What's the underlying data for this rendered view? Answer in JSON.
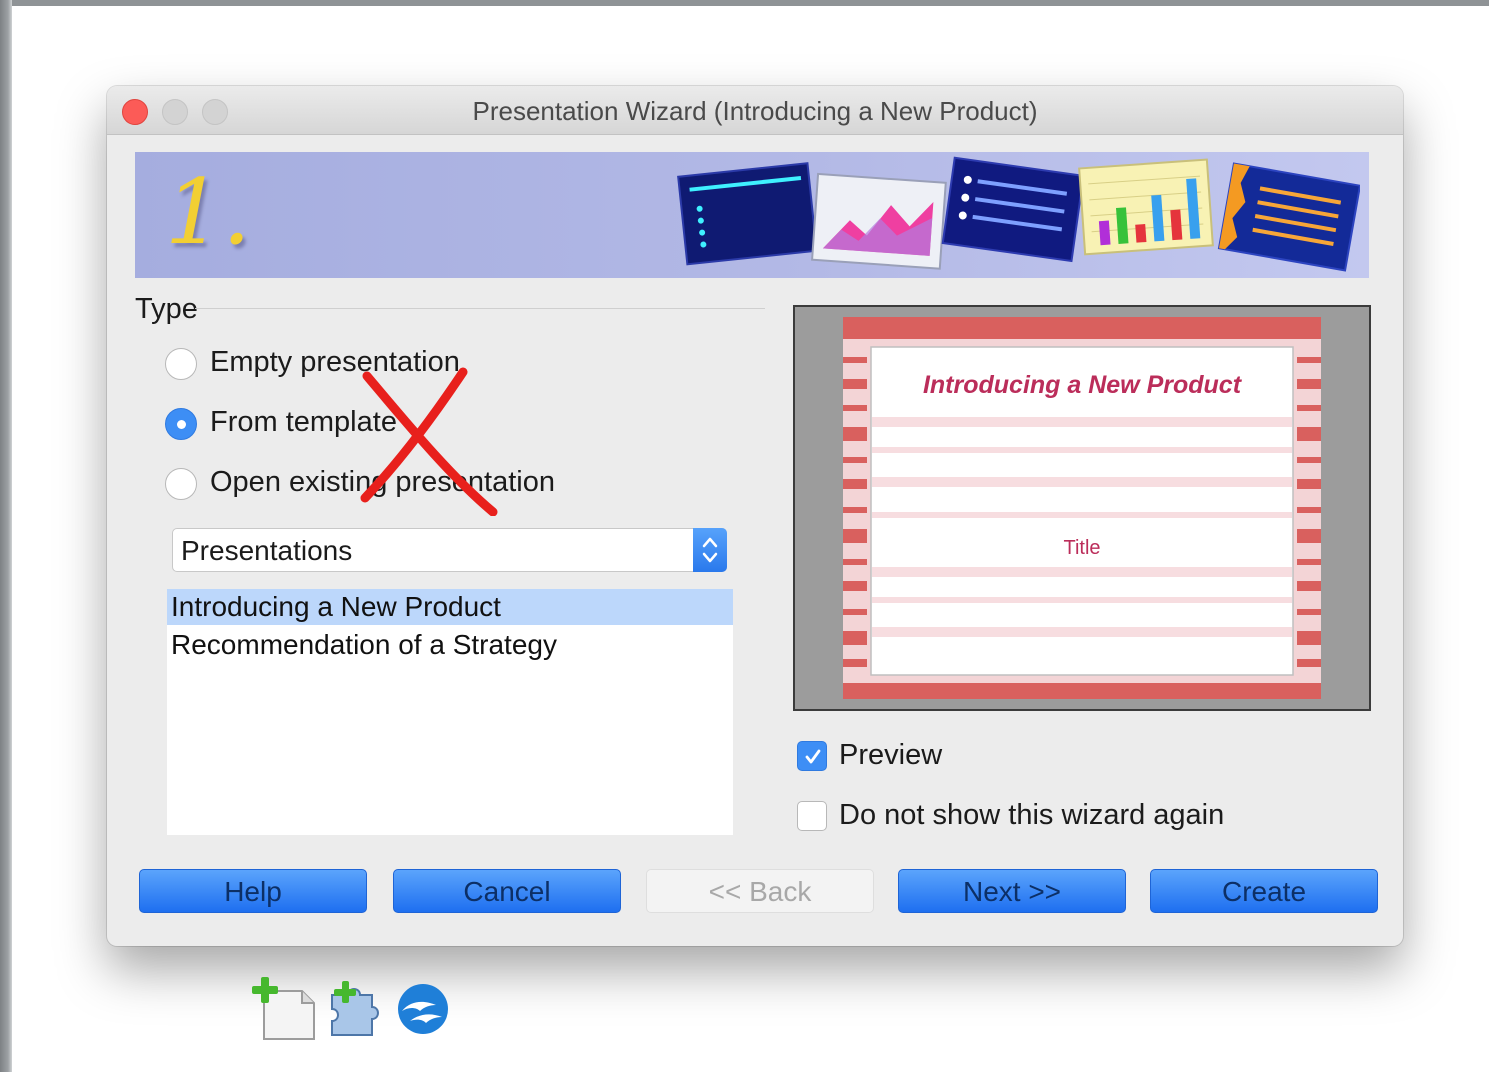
{
  "window": {
    "title": "Presentation Wizard (Introducing a New Product)"
  },
  "banner": {
    "step": "1."
  },
  "type_section": {
    "heading": "Type",
    "options": [
      {
        "label": "Empty presentation",
        "checked": false
      },
      {
        "label": "From template",
        "checked": true
      },
      {
        "label": "Open existing presentation",
        "checked": false
      }
    ]
  },
  "category_select": {
    "value": "Presentations"
  },
  "templates": {
    "items": [
      {
        "label": "Introducing a New Product",
        "selected": true
      },
      {
        "label": "Recommendation of a Strategy",
        "selected": false
      }
    ]
  },
  "preview": {
    "slide_title": "Introducing a New Product",
    "slide_subtitle": "Title"
  },
  "options": {
    "preview_label": "Preview",
    "preview_checked": true,
    "dont_show_label": "Do not show this wizard again",
    "dont_show_checked": false
  },
  "buttons": {
    "help": "Help",
    "cancel": "Cancel",
    "back": "<< Back",
    "next": "Next >>",
    "create": "Create"
  },
  "colors": {
    "accent": "#2f7ae0",
    "close_light": "#fc5b57",
    "banner": "#a5addf",
    "slide_text": "#bb2d5a",
    "annotation": "#e8201c"
  }
}
